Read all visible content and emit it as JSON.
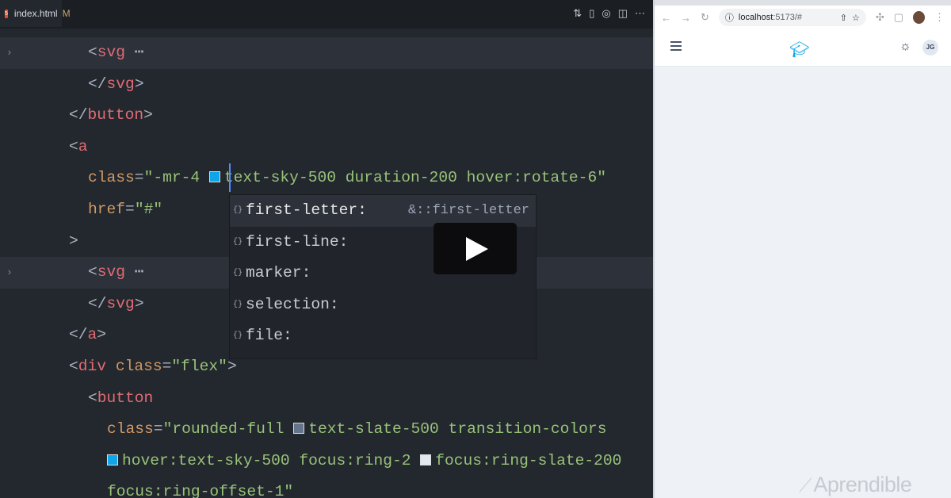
{
  "editor": {
    "tab": {
      "filename": "index.html",
      "status": "M"
    },
    "actions": [
      "compare-icon",
      "open-preview-icon",
      "circle-icon",
      "split-editor-icon",
      "more-icon"
    ],
    "lines": [
      {
        "indent": 2,
        "fold": true,
        "tokens": [
          [
            "punc",
            "<"
          ],
          [
            "tag",
            "svg"
          ],
          [
            "punc",
            " ⋯"
          ]
        ]
      },
      {
        "indent": 2,
        "tokens": [
          [
            "punc",
            "</"
          ],
          [
            "tag",
            "svg"
          ],
          [
            "punc",
            ">"
          ]
        ]
      },
      {
        "indent": 1,
        "tokens": [
          [
            "punc",
            "</"
          ],
          [
            "tag",
            "button"
          ],
          [
            "punc",
            ">"
          ]
        ]
      },
      {
        "indent": 1,
        "tokens": [
          [
            "punc",
            "<"
          ],
          [
            "tag",
            "a"
          ]
        ]
      },
      {
        "indent": 2,
        "tokens": [
          [
            "attr",
            "class"
          ],
          [
            "punc",
            "="
          ],
          [
            "str",
            "\"-mr-4 "
          ],
          [
            "swatch",
            "#0ea5e9"
          ],
          [
            "str",
            "text-sky-500 duration-200 hover:rotate-6\""
          ]
        ]
      },
      {
        "indent": 2,
        "tokens": [
          [
            "attr",
            "href"
          ],
          [
            "punc",
            "="
          ],
          [
            "str",
            "\"#\""
          ]
        ]
      },
      {
        "indent": 1,
        "tokens": [
          [
            "punc",
            ">"
          ]
        ]
      },
      {
        "indent": 2,
        "fold": true,
        "tokens": [
          [
            "punc",
            "<"
          ],
          [
            "tag",
            "svg"
          ],
          [
            "punc",
            " ⋯"
          ]
        ]
      },
      {
        "indent": 2,
        "tokens": [
          [
            "punc",
            "</"
          ],
          [
            "tag",
            "svg"
          ],
          [
            "punc",
            ">"
          ]
        ]
      },
      {
        "indent": 1,
        "tokens": [
          [
            "punc",
            "</"
          ],
          [
            "tag",
            "a"
          ],
          [
            "punc",
            ">"
          ]
        ]
      },
      {
        "indent": 1,
        "tokens": [
          [
            "punc",
            "<"
          ],
          [
            "tag",
            "div"
          ],
          [
            "punc",
            " "
          ],
          [
            "attr",
            "class"
          ],
          [
            "punc",
            "="
          ],
          [
            "str",
            "\"flex\""
          ],
          [
            "punc",
            ">"
          ]
        ]
      },
      {
        "indent": 2,
        "tokens": [
          [
            "punc",
            "<"
          ],
          [
            "tag",
            "button"
          ]
        ]
      },
      {
        "indent": 3,
        "tokens": [
          [
            "attr",
            "class"
          ],
          [
            "punc",
            "="
          ],
          [
            "str",
            "\"rounded-full "
          ],
          [
            "swatch",
            "#64748b"
          ],
          [
            "str",
            "text-slate-500 transition-colors"
          ]
        ]
      },
      {
        "indent": 3,
        "tokens": [
          [
            "swatch",
            "#0ea5e9"
          ],
          [
            "str",
            "hover:text-sky-500 focus:ring-2 "
          ],
          [
            "swatch",
            "#e2e8f0"
          ],
          [
            "str",
            "focus:ring-slate-200"
          ]
        ]
      },
      {
        "indent": 3,
        "tokens": [
          [
            "str",
            "focus:ring-offset-1\""
          ]
        ]
      }
    ],
    "suggestions": [
      {
        "label": "first-letter:",
        "detail": "&::first-letter",
        "selected": true
      },
      {
        "label": "first-line:"
      },
      {
        "label": "marker:"
      },
      {
        "label": "selection:"
      },
      {
        "label": "file:"
      }
    ]
  },
  "browser": {
    "url_host": "localhost",
    "url_rest": ":5173/#",
    "avatar_initials": "JG"
  },
  "watermark": "Aprendible"
}
